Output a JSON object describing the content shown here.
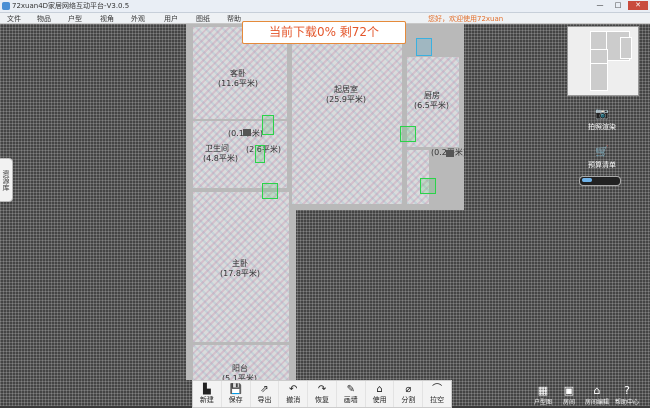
{
  "window": {
    "title": "72xuan4D家居网络互动平台-V3.0.5",
    "min": "—",
    "max": "□",
    "close": "✕"
  },
  "menu": [
    {
      "label": "文件"
    },
    {
      "label": "物品"
    },
    {
      "label": "户型"
    },
    {
      "label": "视角"
    },
    {
      "label": "外观"
    },
    {
      "label": "用户"
    },
    {
      "label": "图纸"
    },
    {
      "label": "帮助"
    }
  ],
  "welcome": "您好，欢迎使用72xuan",
  "banner": "当前下载0% 剩72个",
  "rooms": [
    {
      "name": "客卧",
      "area": "(11.6平米)"
    },
    {
      "name": "起居室",
      "area": "(25.9平米)"
    },
    {
      "name": "厨房",
      "area": "(6.5平米)"
    },
    {
      "name": "卫生间",
      "area": "(4.8平米)"
    },
    {
      "name": "主卧",
      "area": "(17.8平米)"
    },
    {
      "name": "阳台",
      "area": "(5.1平米)"
    }
  ],
  "small_areas": [
    "(0.1平米)",
    "(2.6平米)",
    "(0.2平米)"
  ],
  "side_tab": "资源库",
  "right_tools": [
    {
      "icon": "camera-icon",
      "label": "拍照渲染"
    },
    {
      "icon": "cart-icon",
      "label": "预算清单"
    }
  ],
  "toolbar": [
    {
      "icon": "new-icon",
      "glyph": "▙",
      "label": "新建"
    },
    {
      "icon": "save-icon",
      "glyph": "💾",
      "label": "保存"
    },
    {
      "icon": "export-icon",
      "glyph": "⇗",
      "label": "导出"
    },
    {
      "icon": "undo-icon",
      "glyph": "↶",
      "label": "撤消"
    },
    {
      "icon": "redo-icon",
      "glyph": "↷",
      "label": "恢复"
    },
    {
      "icon": "draw-wall-icon",
      "glyph": "✎",
      "label": "画墙"
    },
    {
      "icon": "use-house-icon",
      "glyph": "⌂",
      "label": "使用"
    },
    {
      "icon": "split-icon",
      "glyph": "⌀",
      "label": "分割"
    },
    {
      "icon": "arc-icon",
      "glyph": "⌒",
      "label": "拉空"
    }
  ],
  "bottom_right": [
    {
      "icon": "layout-icon",
      "label": "户型图"
    },
    {
      "icon": "room-icon",
      "label": "房间"
    },
    {
      "icon": "house-icon",
      "label": "房间编辑"
    },
    {
      "icon": "help-icon",
      "label": "帮助中心"
    }
  ],
  "zoom_level": 0.25
}
